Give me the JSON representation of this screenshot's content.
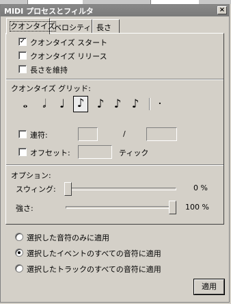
{
  "window": {
    "title": "MIDI プロセスとフィルタ",
    "close_glyph": "×"
  },
  "tabs": [
    {
      "label": "クオンタイズ",
      "active": true
    },
    {
      "label": "ベロシティ",
      "active": false
    },
    {
      "label": "長さ",
      "active": false
    }
  ],
  "quantize_options": [
    {
      "label": "クオンタイズ スタート",
      "checked": true
    },
    {
      "label": "クオンタイズ リリース",
      "checked": false
    },
    {
      "label": "長さを維持",
      "checked": false
    }
  ],
  "grid": {
    "heading": "クオンタイズ グリッド:",
    "notes": [
      {
        "glyph": "𝅝",
        "icon": "whole-note-icon"
      },
      {
        "glyph": "𝅗𝅥",
        "icon": "half-note-icon"
      },
      {
        "glyph": "♩",
        "icon": "quarter-note-icon"
      },
      {
        "glyph": "♪",
        "icon": "eighth-note-icon",
        "selected": true
      },
      {
        "glyph": "♪",
        "icon": "sixteenth-note-icon"
      },
      {
        "glyph": "♪",
        "icon": "thirty-second-note-icon"
      },
      {
        "glyph": "♪",
        "icon": "sixty-fourth-note-icon"
      }
    ],
    "dot_glyph": "·"
  },
  "tuplet": {
    "label": "連符:",
    "checked": false,
    "value1": "",
    "separator": "/",
    "value2": ""
  },
  "offset": {
    "label": "オフセット:",
    "checked": false,
    "value": "",
    "unit": "ティック"
  },
  "options": {
    "heading": "オプション:",
    "swing": {
      "label": "スウィング:",
      "value": "0 %",
      "level": 0
    },
    "strength": {
      "label": "強さ:",
      "value": "100 %",
      "level": 1
    }
  },
  "apply_scope": [
    {
      "label": "選択した音符のみに適用",
      "selected": false
    },
    {
      "label": "選択したイベントのすべての音符に適用",
      "selected": true
    },
    {
      "label": "選択したトラックのすべての音符に適用",
      "selected": false
    }
  ],
  "apply_button": "適用"
}
